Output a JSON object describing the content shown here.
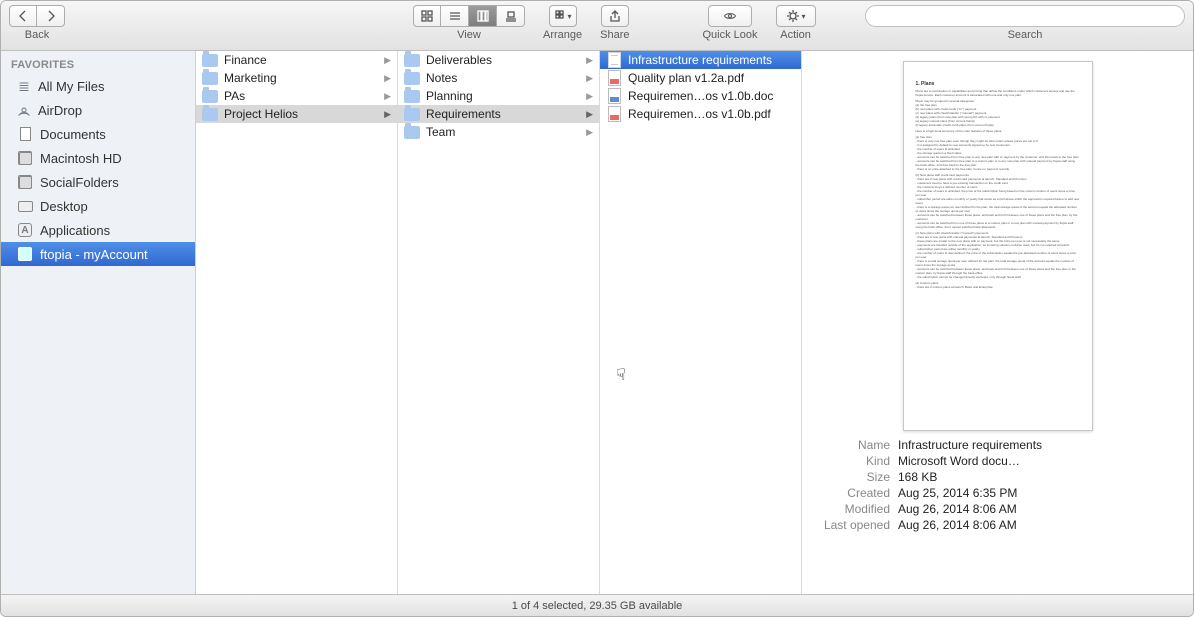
{
  "toolbar": {
    "back_label": "Back",
    "view_label": "View",
    "arrange_label": "Arrange",
    "share_label": "Share",
    "quicklook_label": "Quick Look",
    "action_label": "Action",
    "search_label": "Search",
    "search_placeholder": ""
  },
  "sidebar": {
    "header": "FAVORITES",
    "items": [
      {
        "label": "All My Files",
        "icon": "all-my-files"
      },
      {
        "label": "AirDrop",
        "icon": "airdrop"
      },
      {
        "label": "Documents",
        "icon": "documents"
      },
      {
        "label": "Macintosh HD",
        "icon": "hard-drive"
      },
      {
        "label": "SocialFolders",
        "icon": "hard-drive"
      },
      {
        "label": "Desktop",
        "icon": "desktop"
      },
      {
        "label": "Applications",
        "icon": "applications"
      },
      {
        "label": "ftopia - myAccount",
        "icon": "folder",
        "selected": true
      }
    ]
  },
  "columns": [
    {
      "items": [
        {
          "label": "Finance",
          "type": "folder"
        },
        {
          "label": "Marketing",
          "type": "folder"
        },
        {
          "label": "PAs",
          "type": "folder"
        },
        {
          "label": "Project Helios",
          "type": "folder",
          "selected": "path"
        }
      ]
    },
    {
      "items": [
        {
          "label": "Deliverables",
          "type": "folder"
        },
        {
          "label": "Notes",
          "type": "folder"
        },
        {
          "label": "Planning",
          "type": "folder"
        },
        {
          "label": "Requirements",
          "type": "folder",
          "selected": "path"
        },
        {
          "label": "Team",
          "type": "folder"
        }
      ]
    },
    {
      "items": [
        {
          "label": "Infrastructure requirements",
          "type": "word",
          "selected": "active"
        },
        {
          "label": "Quality plan v1.2a.pdf",
          "type": "pdf"
        },
        {
          "label": "Requiremen…os v1.0b.doc",
          "type": "doc"
        },
        {
          "label": "Requiremen…os v1.0b.pdf",
          "type": "pdf"
        }
      ]
    }
  ],
  "preview": {
    "meta": {
      "name_label": "Name",
      "name_value": "Infrastructure requirements",
      "kind_label": "Kind",
      "kind_value": "Microsoft Word docu…",
      "size_label": "Size",
      "size_value": "168 KB",
      "created_label": "Created",
      "created_value": "Aug 25, 2014 6:35 PM",
      "modified_label": "Modified",
      "modified_value": "Aug 26, 2014 8:06 AM",
      "lastopened_label": "Last opened",
      "lastopened_value": "Aug 26, 2014 8:06 AM"
    }
  },
  "status": "1 of 4 selected, 29.35 GB available"
}
